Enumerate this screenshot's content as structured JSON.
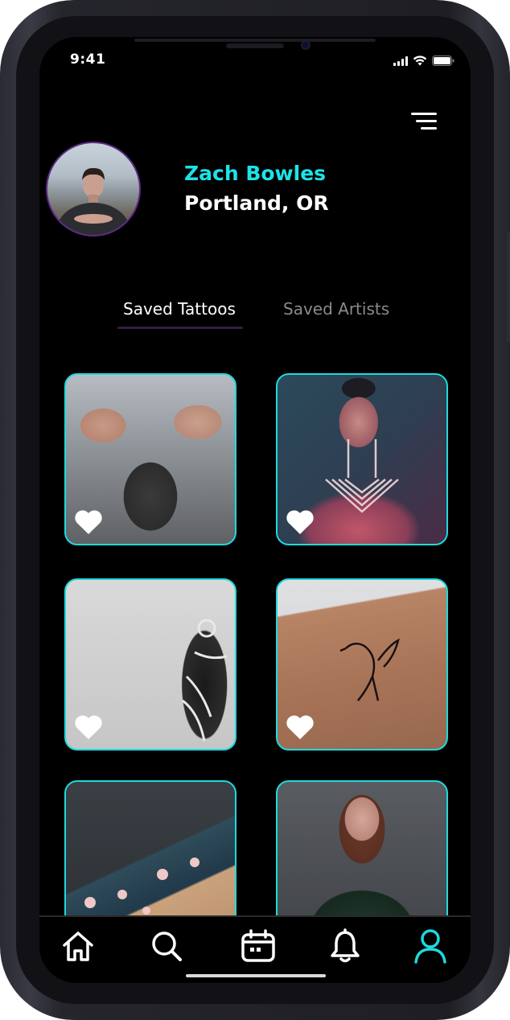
{
  "status_bar": {
    "time": "9:41"
  },
  "profile": {
    "name": "Zach Bowles",
    "location": "Portland, OR"
  },
  "tabs": [
    {
      "label": "Saved Tattoos",
      "active": true
    },
    {
      "label": "Saved Artists",
      "active": false
    }
  ],
  "saved_tattoos": [
    {
      "liked": true
    },
    {
      "liked": true
    },
    {
      "liked": true
    },
    {
      "liked": true
    },
    {
      "liked": false
    },
    {
      "liked": false
    }
  ],
  "bottom_nav": {
    "items": [
      "home-icon",
      "search-icon",
      "calendar-icon",
      "bell-icon",
      "user-icon"
    ],
    "active": "user-icon"
  },
  "colors": {
    "accent": "#1fd9dd",
    "name": "#1ce3e6",
    "background": "#000000",
    "inactive_tab": "#8a8a8a",
    "tab_underline": "#341c44"
  }
}
